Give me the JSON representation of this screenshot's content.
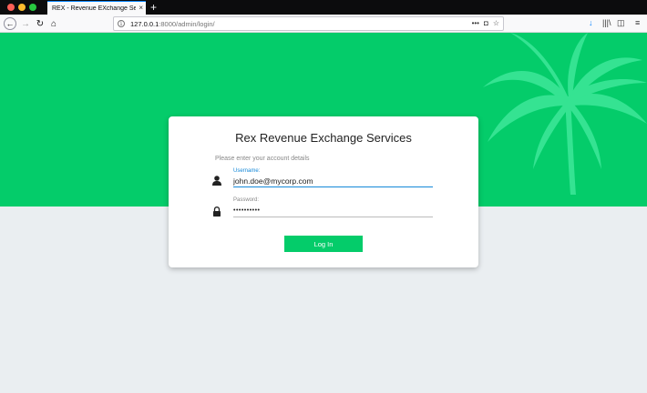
{
  "browser": {
    "tab_title": "REX - Revenue EXchange Service",
    "tab_close": "×",
    "new_tab": "+",
    "url_host": "127.0.0.1",
    "url_path": ":8000/admin/login/",
    "url_actions": {
      "more": "•••",
      "pocket": "◘",
      "bookmark": "☆"
    },
    "icons": {
      "back": "←",
      "forward": "→",
      "reload": "↻",
      "home": "⌂",
      "download": "↓",
      "library": "|||\\",
      "sidebar": "◫",
      "menu": "≡"
    }
  },
  "login": {
    "title": "Rex Revenue Exchange Services",
    "subtitle": "Please enter your account details",
    "username_label": "Username:",
    "username_value": "john.doe@mycorp.com",
    "password_label": "Password:",
    "password_value": "••••••••••",
    "submit_label": "Log In"
  },
  "colors": {
    "brand_green": "#04cc6a",
    "focus_blue": "#1488d8",
    "background": "#eaeef1"
  }
}
